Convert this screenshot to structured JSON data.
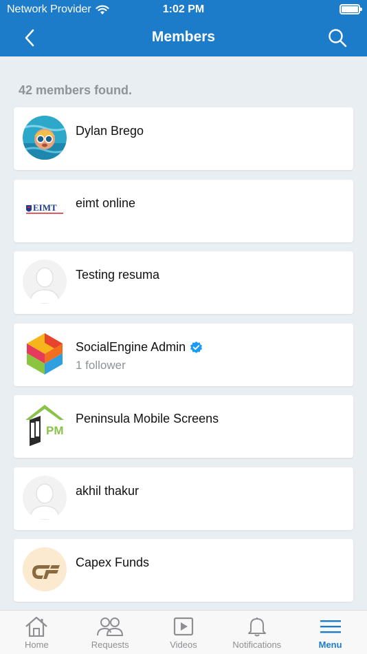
{
  "status": {
    "carrier": "Network Provider",
    "time": "1:02 PM"
  },
  "header": {
    "title": "Members"
  },
  "results": {
    "count_text": "42 members found."
  },
  "members": [
    {
      "name": "Dylan Brego",
      "avatar": "photo-swimmer"
    },
    {
      "name": "eimt online",
      "avatar": "eimt-logo",
      "logo_text": "EIMT"
    },
    {
      "name": "Testing resuma",
      "avatar": "default-avatar"
    },
    {
      "name": "SocialEngine Admin",
      "avatar": "socialengine-logo",
      "verified": true,
      "sub": "1 follower"
    },
    {
      "name": "Peninsula Mobile Screens",
      "avatar": "pm-logo",
      "logo_text": "PM"
    },
    {
      "name": "akhil thakur",
      "avatar": "default-avatar"
    },
    {
      "name": "Capex Funds",
      "avatar": "capex-logo"
    }
  ],
  "tabs": [
    {
      "label": "Home",
      "icon": "home-icon"
    },
    {
      "label": "Requests",
      "icon": "people-icon"
    },
    {
      "label": "Videos",
      "icon": "video-icon"
    },
    {
      "label": "Notifications",
      "icon": "bell-icon"
    },
    {
      "label": "Menu",
      "icon": "menu-icon",
      "active": true
    }
  ],
  "colors": {
    "brand": "#1c7cc9",
    "background": "#e9eef2",
    "muted": "#8d9399",
    "verified": "#1d9bf0"
  }
}
